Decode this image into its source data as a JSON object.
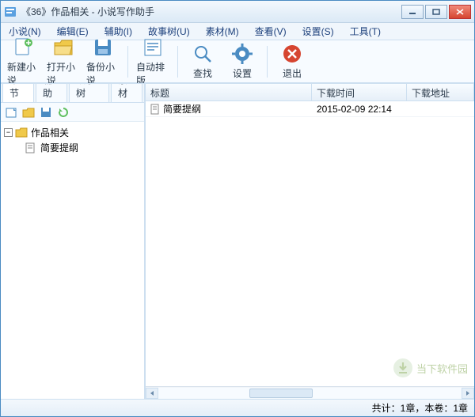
{
  "window": {
    "title": "《36》作品相关 - 小说写作助手"
  },
  "menu": {
    "items": [
      "小说(N)",
      "编辑(E)",
      "辅助(I)",
      "故事树(U)",
      "素材(M)",
      "查看(V)",
      "设置(S)",
      "工具(T)"
    ]
  },
  "toolbar": {
    "new": "新建小说",
    "open": "打开小说",
    "backup": "备份小说",
    "typeset": "自动排版",
    "find": "查找",
    "settings": "设置",
    "exit": "退出"
  },
  "tabs": {
    "items": [
      "章节",
      "辅助",
      "故事树",
      "素材"
    ],
    "active": 0
  },
  "tree": {
    "root": "作品相关",
    "child": "简要提纲"
  },
  "columns": {
    "title": "标题",
    "time": "下载时间",
    "url": "下载地址"
  },
  "rows": [
    {
      "title": "简要提纲",
      "time": "2015-02-09 22:14",
      "url": ""
    }
  ],
  "status": {
    "text": "共计：1章，本卷：1章"
  },
  "watermark": {
    "text": "当下软件园"
  }
}
